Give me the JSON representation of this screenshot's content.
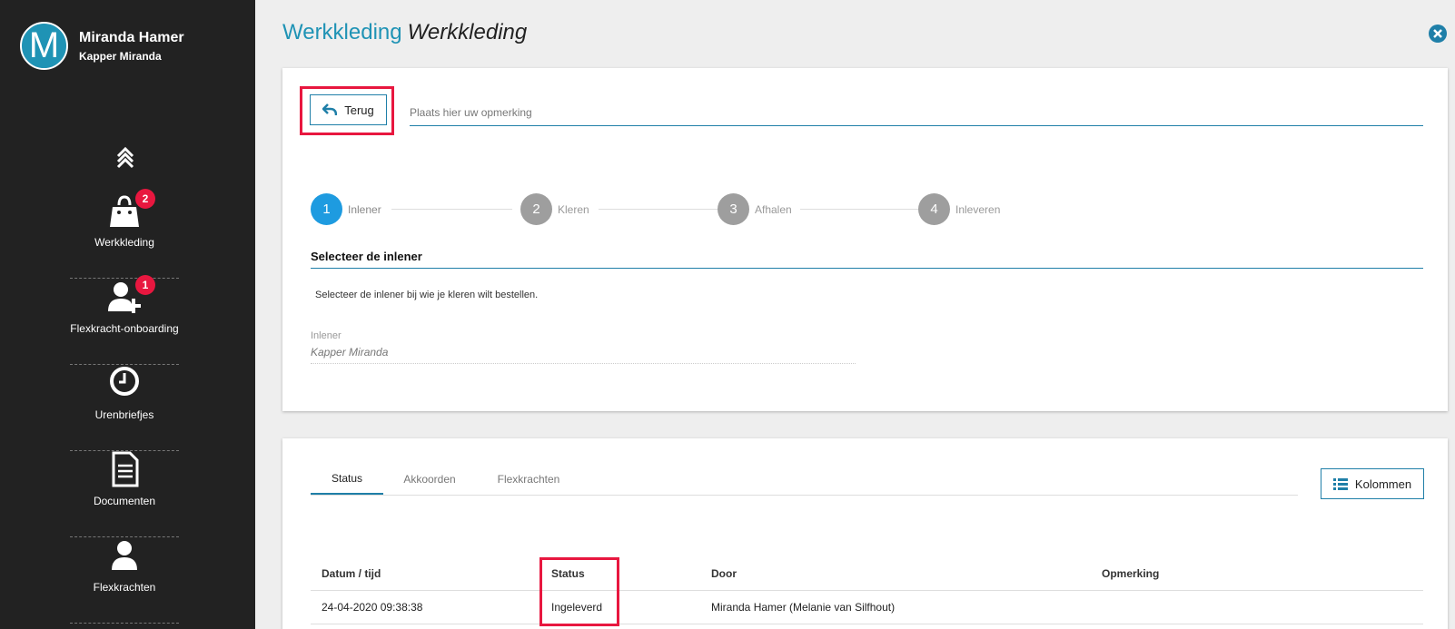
{
  "user": {
    "initial": "M",
    "name": "Miranda Hamer",
    "company": "Kapper Miranda"
  },
  "sidebar": {
    "items": [
      {
        "label": "Werkkleding",
        "badge": "2"
      },
      {
        "label": "Flexkracht-onboarding",
        "badge": "1"
      },
      {
        "label": "Urenbriefjes"
      },
      {
        "label": "Documenten"
      },
      {
        "label": "Flexkrachten"
      }
    ]
  },
  "header": {
    "title": "Werkkleding",
    "subtitle": "Werkkleding"
  },
  "form": {
    "back_label": "Terug",
    "remark_placeholder": "Plaats hier uw opmerking"
  },
  "steps": [
    {
      "number": "1",
      "label": "Inlener",
      "active": true
    },
    {
      "number": "2",
      "label": "Kleren",
      "active": false
    },
    {
      "number": "3",
      "label": "Afhalen",
      "active": false
    },
    {
      "number": "4",
      "label": "Inleveren",
      "active": false
    }
  ],
  "section": {
    "title": "Selecteer de inlener",
    "description": "Selecteer de inlener bij wie je kleren wilt bestellen.",
    "field_label": "Inlener",
    "field_value": "Kapper Miranda"
  },
  "tabs": [
    {
      "label": "Status",
      "active": true
    },
    {
      "label": "Akkoorden",
      "active": false
    },
    {
      "label": "Flexkrachten",
      "active": false
    }
  ],
  "columns_button": "Kolommen",
  "table": {
    "headers": [
      "Datum / tijd",
      "Status",
      "Door",
      "Opmerking"
    ],
    "rows": [
      [
        "24-04-2020 09:38:38",
        "Ingeleverd",
        "Miranda Hamer (Melanie van Silfhout)",
        ""
      ]
    ]
  },
  "colors": {
    "accent": "#1f93b5",
    "highlight": "#e8173f",
    "sidebar": "#222222",
    "step_active": "#1e9be0",
    "badge": "#e8173f"
  }
}
